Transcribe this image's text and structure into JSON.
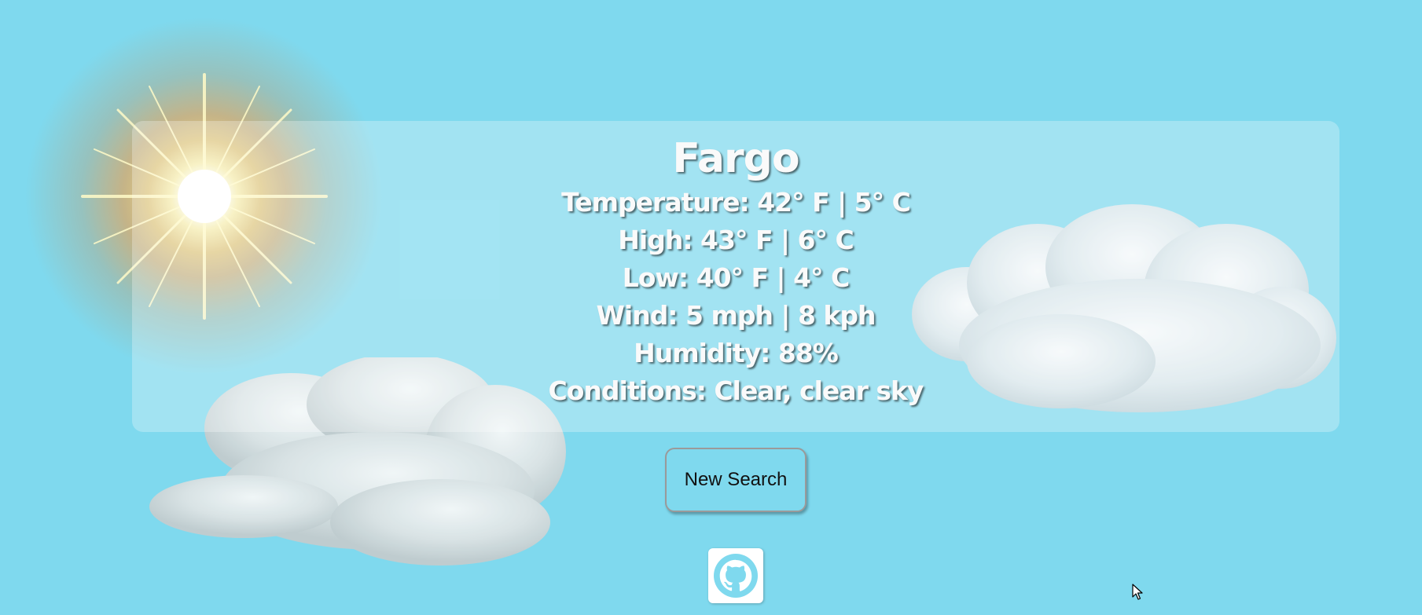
{
  "weather": {
    "city": "Fargo",
    "temperature": "Temperature: 42° F | 5° C",
    "high": "High: 43° F | 6° C",
    "low": "Low: 40° F | 4° C",
    "wind": "Wind: 5 mph | 8 kph",
    "humidity": "Humidity: 88%",
    "conditions": "Conditions: Clear, clear sky"
  },
  "actions": {
    "new_search_label": "New Search"
  },
  "footer": {
    "github_icon": "github-icon"
  },
  "colors": {
    "background": "#7fd9ee",
    "card_overlay": "rgba(255,255,255,0.28)",
    "text": "#fafafa",
    "icon_color": "#7fd9ee"
  }
}
